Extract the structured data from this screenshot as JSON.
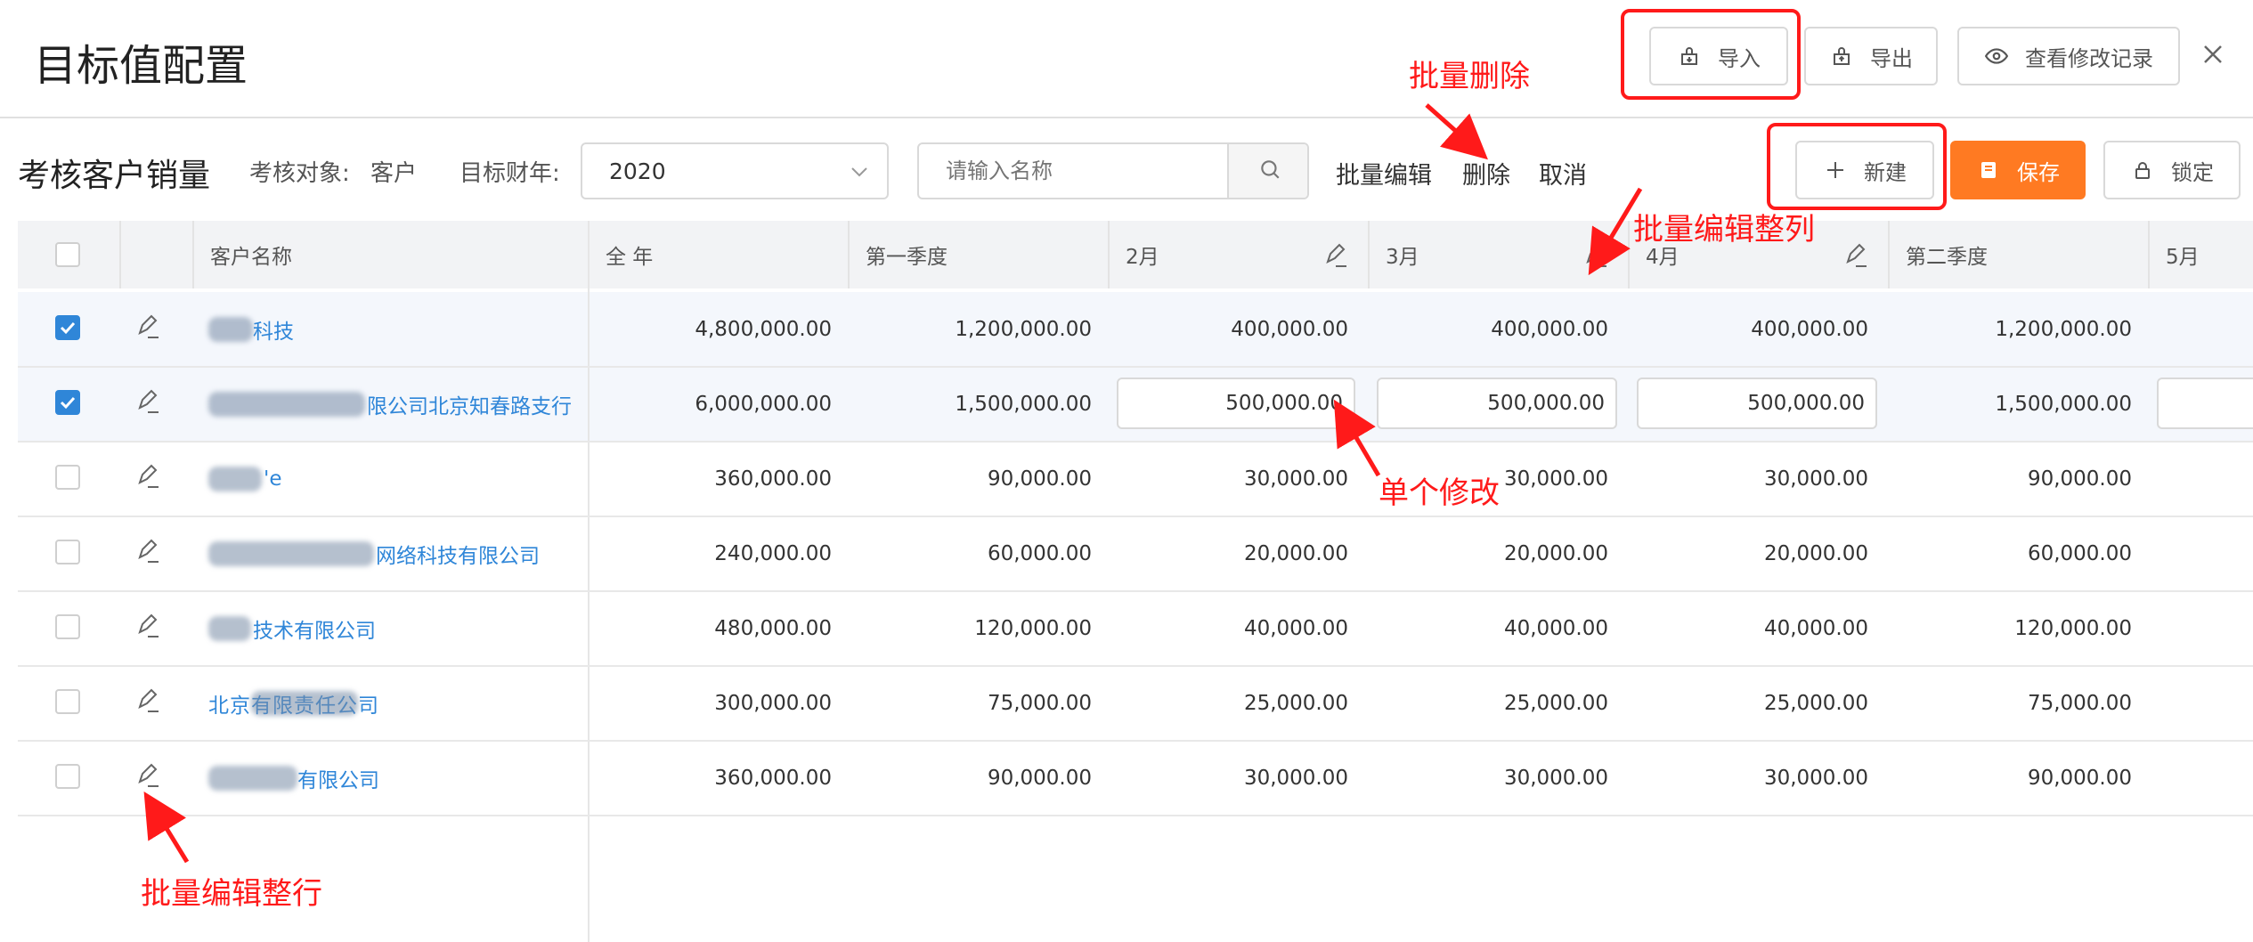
{
  "header": {
    "title": "目标值配置",
    "import_label": "导入",
    "export_label": "导出",
    "history_label": "查看修改记录"
  },
  "toolbar": {
    "section_title": "考核客户销量",
    "target_label": "考核对象:",
    "target_value": "客户",
    "year_label": "目标财年:",
    "year_value": "2020",
    "search_placeholder": "请输入名称",
    "batch_edit": "批量编辑",
    "delete": "删除",
    "cancel": "取消",
    "new_label": "新建",
    "save_label": "保存",
    "lock_label": "锁定"
  },
  "table": {
    "columns": [
      "客户名称",
      "全 年",
      "第一季度",
      "2月",
      "3月",
      "4月",
      "第二季度",
      "5月"
    ],
    "rows": [
      {
        "checked": true,
        "name": "科技",
        "annual": "4,800,000.00",
        "q1": "1,200,000.00",
        "m2": "400,000.00",
        "m3": "400,000.00",
        "m4": "400,000.00",
        "q2": "1,200,000.00"
      },
      {
        "checked": true,
        "name": "限公司北京知春路支行",
        "annual": "6,000,000.00",
        "q1": "1,500,000.00",
        "m2": "500,000.00",
        "m3": "500,000.00",
        "m4": "500,000.00",
        "q2": "1,500,000.00"
      },
      {
        "checked": false,
        "name": "'e",
        "annual": "360,000.00",
        "q1": "90,000.00",
        "m2": "30,000.00",
        "m3": "30,000.00",
        "m4": "30,000.00",
        "q2": "90,000.00"
      },
      {
        "checked": false,
        "name": "网络科技有限公司",
        "annual": "240,000.00",
        "q1": "60,000.00",
        "m2": "20,000.00",
        "m3": "20,000.00",
        "m4": "20,000.00",
        "q2": "60,000.00"
      },
      {
        "checked": false,
        "name": "技术有限公司",
        "annual": "480,000.00",
        "q1": "120,000.00",
        "m2": "40,000.00",
        "m3": "40,000.00",
        "m4": "40,000.00",
        "q2": "120,000.00"
      },
      {
        "checked": false,
        "name": "北京有限责任公司",
        "annual": "300,000.00",
        "q1": "75,000.00",
        "m2": "25,000.00",
        "m3": "25,000.00",
        "m4": "25,000.00",
        "q2": "75,000.00"
      },
      {
        "checked": false,
        "name": "有限公司",
        "annual": "360,000.00",
        "q1": "90,000.00",
        "m2": "30,000.00",
        "m3": "30,000.00",
        "m4": "30,000.00",
        "q2": "90,000.00"
      }
    ]
  },
  "annotations": {
    "batch_delete": "批量删除",
    "batch_edit_column": "批量编辑整列",
    "single_edit": "单个修改",
    "batch_edit_row": "批量编辑整行"
  },
  "colors": {
    "accent": "#2f86d8",
    "save": "#ff7a22",
    "annotation": "#ff1a1a"
  },
  "icons": [
    "import-icon",
    "export-icon",
    "eye-icon",
    "close-icon",
    "chevron-down-icon",
    "search-icon",
    "plus-icon",
    "save-icon",
    "lock-icon",
    "pencil-icon",
    "check-icon"
  ]
}
